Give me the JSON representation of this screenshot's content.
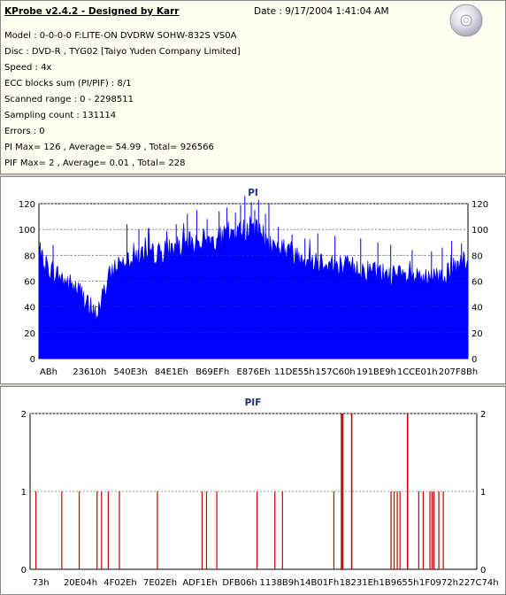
{
  "header": {
    "title": "KProbe v2.4.2 - Designed by Karr",
    "date": "Date : 9/17/2004 1:41:04 AM",
    "lines": [
      "Model : 0-0-0-0 F:LITE-ON DVDRW SOHW-832S  VS0A",
      "Disc : DVD-R , TYG02 [Taiyo Yuden Company Limited]",
      "Speed : 4x",
      "ECC blocks sum (PI/PIF) : 8/1",
      "Scanned range : 0 - 2298511",
      "Sampling count : 131114",
      "Errors : 0",
      "PI Max= 126 , Average= 54.99 , Total= 926566",
      "PIF Max= 2 , Average= 0.01 , Total= 228"
    ]
  },
  "colors": {
    "pi": "#0000ff",
    "pif": "#cc0000",
    "title": "#1c2f85",
    "grid": "#999999"
  },
  "chart_data": [
    {
      "type": "area",
      "title": "PI",
      "ylim": [
        0,
        120
      ],
      "yticks": [
        0,
        20,
        40,
        60,
        80,
        100,
        120
      ],
      "xticks": [
        "ABh",
        "23610h",
        "540E3h",
        "84E1Eh",
        "B69EFh",
        "E876Eh",
        "11DE55h",
        "157C60h",
        "191BE9h",
        "1CCE01h",
        "207F8Bh"
      ],
      "grid": true,
      "envelope": [
        {
          "x": 0.0,
          "y": 78
        },
        {
          "x": 0.012,
          "y": 74
        },
        {
          "x": 0.025,
          "y": 70
        },
        {
          "x": 0.04,
          "y": 66
        },
        {
          "x": 0.055,
          "y": 62
        },
        {
          "x": 0.07,
          "y": 58
        },
        {
          "x": 0.085,
          "y": 55
        },
        {
          "x": 0.1,
          "y": 50
        },
        {
          "x": 0.112,
          "y": 42
        },
        {
          "x": 0.122,
          "y": 36
        },
        {
          "x": 0.132,
          "y": 34
        },
        {
          "x": 0.142,
          "y": 40
        },
        {
          "x": 0.155,
          "y": 55
        },
        {
          "x": 0.17,
          "y": 68
        },
        {
          "x": 0.19,
          "y": 76
        },
        {
          "x": 0.21,
          "y": 79
        },
        {
          "x": 0.235,
          "y": 80
        },
        {
          "x": 0.26,
          "y": 81
        },
        {
          "x": 0.285,
          "y": 82
        },
        {
          "x": 0.31,
          "y": 85
        },
        {
          "x": 0.335,
          "y": 88
        },
        {
          "x": 0.36,
          "y": 90
        },
        {
          "x": 0.385,
          "y": 91
        },
        {
          "x": 0.41,
          "y": 92
        },
        {
          "x": 0.435,
          "y": 95
        },
        {
          "x": 0.46,
          "y": 98
        },
        {
          "x": 0.48,
          "y": 100
        },
        {
          "x": 0.495,
          "y": 102
        },
        {
          "x": 0.51,
          "y": 99
        },
        {
          "x": 0.525,
          "y": 94
        },
        {
          "x": 0.54,
          "y": 89
        },
        {
          "x": 0.56,
          "y": 86
        },
        {
          "x": 0.585,
          "y": 83
        },
        {
          "x": 0.61,
          "y": 80
        },
        {
          "x": 0.64,
          "y": 77
        },
        {
          "x": 0.67,
          "y": 75
        },
        {
          "x": 0.7,
          "y": 73
        },
        {
          "x": 0.73,
          "y": 71
        },
        {
          "x": 0.76,
          "y": 69
        },
        {
          "x": 0.79,
          "y": 67
        },
        {
          "x": 0.82,
          "y": 65
        },
        {
          "x": 0.85,
          "y": 63
        },
        {
          "x": 0.88,
          "y": 62
        },
        {
          "x": 0.905,
          "y": 61
        },
        {
          "x": 0.925,
          "y": 63
        },
        {
          "x": 0.945,
          "y": 66
        },
        {
          "x": 0.965,
          "y": 69
        },
        {
          "x": 0.985,
          "y": 72
        },
        {
          "x": 1.0,
          "y": 74
        }
      ],
      "peaks": [
        {
          "x": 0.003,
          "y": 90
        },
        {
          "x": 0.033,
          "y": 88
        },
        {
          "x": 0.205,
          "y": 104
        },
        {
          "x": 0.233,
          "y": 100
        },
        {
          "x": 0.255,
          "y": 101
        },
        {
          "x": 0.32,
          "y": 104
        },
        {
          "x": 0.346,
          "y": 112
        },
        {
          "x": 0.368,
          "y": 115
        },
        {
          "x": 0.392,
          "y": 108
        },
        {
          "x": 0.42,
          "y": 114
        },
        {
          "x": 0.438,
          "y": 117
        },
        {
          "x": 0.458,
          "y": 113
        },
        {
          "x": 0.47,
          "y": 119
        },
        {
          "x": 0.48,
          "y": 126
        },
        {
          "x": 0.495,
          "y": 121
        },
        {
          "x": 0.503,
          "y": 115
        },
        {
          "x": 0.512,
          "y": 123
        },
        {
          "x": 0.528,
          "y": 112
        },
        {
          "x": 0.536,
          "y": 120
        },
        {
          "x": 0.558,
          "y": 102
        },
        {
          "x": 0.59,
          "y": 96
        },
        {
          "x": 0.62,
          "y": 93
        },
        {
          "x": 0.65,
          "y": 97
        },
        {
          "x": 0.69,
          "y": 95
        },
        {
          "x": 0.75,
          "y": 93
        },
        {
          "x": 0.79,
          "y": 90
        },
        {
          "x": 0.82,
          "y": 88
        },
        {
          "x": 0.87,
          "y": 84
        },
        {
          "x": 0.915,
          "y": 83
        },
        {
          "x": 0.94,
          "y": 86
        },
        {
          "x": 0.962,
          "y": 91
        },
        {
          "x": 0.985,
          "y": 89
        }
      ]
    },
    {
      "type": "bar",
      "title": "PIF",
      "ylim": [
        0,
        2
      ],
      "yticks": [
        0,
        1,
        2
      ],
      "xticks": [
        "73h",
        "20E04h",
        "4F02Eh",
        "7E02Eh",
        "ADF1Eh",
        "DFB06h",
        "1138B9h",
        "14B01Fh",
        "18231Eh",
        "1B9655h",
        "1F0972h",
        "227C74h"
      ],
      "grid": true,
      "events": [
        {
          "x": 0.013,
          "y": 1
        },
        {
          "x": 0.071,
          "y": 1
        },
        {
          "x": 0.11,
          "y": 1
        },
        {
          "x": 0.15,
          "y": 1
        },
        {
          "x": 0.16,
          "y": 1
        },
        {
          "x": 0.175,
          "y": 1
        },
        {
          "x": 0.2,
          "y": 1
        },
        {
          "x": 0.285,
          "y": 1
        },
        {
          "x": 0.385,
          "y": 1
        },
        {
          "x": 0.395,
          "y": 1
        },
        {
          "x": 0.418,
          "y": 1
        },
        {
          "x": 0.508,
          "y": 1
        },
        {
          "x": 0.548,
          "y": 1
        },
        {
          "x": 0.565,
          "y": 1
        },
        {
          "x": 0.68,
          "y": 1
        },
        {
          "x": 0.697,
          "y": 2
        },
        {
          "x": 0.7,
          "y": 2
        },
        {
          "x": 0.72,
          "y": 2
        },
        {
          "x": 0.808,
          "y": 1
        },
        {
          "x": 0.815,
          "y": 1
        },
        {
          "x": 0.822,
          "y": 1
        },
        {
          "x": 0.828,
          "y": 1
        },
        {
          "x": 0.845,
          "y": 2
        },
        {
          "x": 0.87,
          "y": 1
        },
        {
          "x": 0.88,
          "y": 1
        },
        {
          "x": 0.895,
          "y": 1
        },
        {
          "x": 0.9,
          "y": 1
        },
        {
          "x": 0.904,
          "y": 1
        },
        {
          "x": 0.915,
          "y": 1
        },
        {
          "x": 0.925,
          "y": 1
        }
      ]
    }
  ]
}
